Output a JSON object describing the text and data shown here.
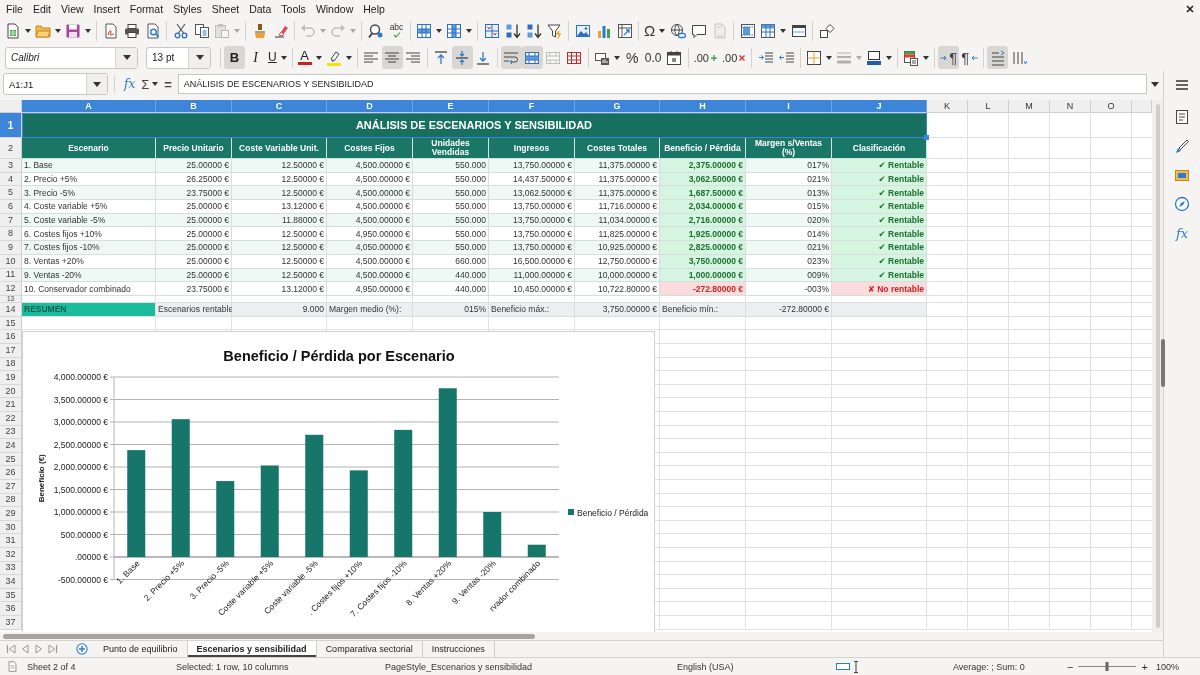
{
  "menu_bar": [
    "File",
    "Edit",
    "View",
    "Insert",
    "Format",
    "Styles",
    "Sheet",
    "Data",
    "Tools",
    "Window",
    "Help"
  ],
  "standard_toolbar": {
    "paste": {
      "disabled": true
    },
    "undo": {
      "disabled": true
    },
    "redo": {
      "disabled": true
    },
    "spelling": "abc",
    "special_character": "Ω",
    "headers_footers": {
      "disabled": true
    }
  },
  "formatting_toolbar": {
    "font_name": "Calibri",
    "font_size": "13 pt",
    "bold": {
      "label": "B",
      "on": true
    },
    "italic": {
      "label": "I",
      "on": false
    },
    "underline": {
      "label": "U",
      "on": false
    },
    "font_color": {
      "label": "A"
    },
    "align_left": {
      "on": false
    },
    "align_center": {
      "on": true
    },
    "align_right": {
      "on": false
    },
    "align_top": {
      "on": false
    },
    "align_middle": {
      "on": true
    },
    "align_bottom": {
      "on": false
    },
    "wrap_text": {
      "on": true
    },
    "merge_and_center": {
      "on": true
    },
    "merge_cells": {
      "disabled": true
    },
    "percent": "%",
    "standard_number": "0.0",
    "add_decimal": ".00",
    "delete_decimal": ".00",
    "border_style": {
      "disabled": true
    },
    "left_to_right": {
      "label": "¶",
      "on": true
    },
    "right_to_left": {
      "label": "¶",
      "on": false
    },
    "text_horizontal": {
      "on": true
    },
    "text_vertical": {
      "on": false
    }
  },
  "formula_bar": {
    "name_box": "A1:J1",
    "function_wizard": "fx",
    "sum": "Σ",
    "equals": "=",
    "content": "ANÁLISIS DE ESCENARIOS Y SENSIBILIDAD"
  },
  "column_headers": [
    {
      "label": "A",
      "selected": true
    },
    {
      "label": "B",
      "selected": true
    },
    {
      "label": "C",
      "selected": true
    },
    {
      "label": "D",
      "selected": true
    },
    {
      "label": "E",
      "selected": true
    },
    {
      "label": "F",
      "selected": true
    },
    {
      "label": "G",
      "selected": true
    },
    {
      "label": "H",
      "selected": true
    },
    {
      "label": "I",
      "selected": true
    },
    {
      "label": "J",
      "selected": true
    },
    {
      "label": "K",
      "selected": false
    },
    {
      "label": "L",
      "selected": false
    },
    {
      "label": "M",
      "selected": false
    },
    {
      "label": "N",
      "selected": false
    },
    {
      "label": "O",
      "selected": false
    }
  ],
  "row_headers": [
    {
      "label": "1",
      "selected": true
    },
    {
      "label": "2",
      "selected": false
    },
    {
      "label": "3",
      "selected": false
    },
    {
      "label": "4",
      "selected": false
    },
    {
      "label": "5",
      "selected": false
    },
    {
      "label": "6",
      "selected": false
    },
    {
      "label": "7",
      "selected": false
    },
    {
      "label": "8",
      "selected": false
    },
    {
      "label": "9",
      "selected": false
    },
    {
      "label": "10",
      "selected": false
    },
    {
      "label": "11",
      "selected": false
    },
    {
      "label": "12",
      "selected": false
    },
    {
      "label": "13",
      "selected": false
    },
    {
      "label": "14",
      "selected": false
    },
    {
      "label": "15",
      "selected": false
    },
    {
      "label": "16",
      "selected": false
    },
    {
      "label": "17",
      "selected": false
    },
    {
      "label": "18",
      "selected": false
    },
    {
      "label": "19",
      "selected": false
    },
    {
      "label": "20",
      "selected": false
    },
    {
      "label": "21",
      "selected": false
    },
    {
      "label": "22",
      "selected": false
    },
    {
      "label": "23",
      "selected": false
    },
    {
      "label": "24",
      "selected": false
    },
    {
      "label": "25",
      "selected": false
    },
    {
      "label": "26",
      "selected": false
    },
    {
      "label": "27",
      "selected": false
    },
    {
      "label": "28",
      "selected": false
    },
    {
      "label": "29",
      "selected": false
    },
    {
      "label": "30",
      "selected": false
    },
    {
      "label": "31",
      "selected": false
    },
    {
      "label": "32",
      "selected": false
    },
    {
      "label": "33",
      "selected": false
    },
    {
      "label": "34",
      "selected": false
    },
    {
      "label": "35",
      "selected": false
    },
    {
      "label": "36",
      "selected": false
    },
    {
      "label": "37",
      "selected": false
    }
  ],
  "sheet": {
    "title": "ANÁLISIS DE ESCENARIOS Y SENSIBILIDAD",
    "headers": [
      "Escenario",
      "Precio Unitario",
      "Coste Variable Unit.",
      "Costes Fijos",
      "Unidades Vendidas",
      "Ingresos",
      "Costes Totales",
      "Beneficio / Pérdida",
      "Margen s/Ventas (%)",
      "Clasificación"
    ],
    "scenarios": [
      {
        "cells": [
          "1. Base",
          "25.00000 €",
          "12.50000 €",
          "4,500.00000 €",
          "550.000",
          "13,750.00000 €",
          "11,375.00000 €",
          "2,375.00000 €",
          "017%",
          "✔ Rentable"
        ],
        "profitable": true
      },
      {
        "cells": [
          "2. Precio +5%",
          "26.25000 €",
          "12.50000 €",
          "4,500.00000 €",
          "550.000",
          "14,437.50000 €",
          "11,375.00000 €",
          "3,062.50000 €",
          "021%",
          "✔ Rentable"
        ],
        "profitable": true
      },
      {
        "cells": [
          "3. Precio -5%",
          "23.75000 €",
          "12.50000 €",
          "4,500.00000 €",
          "550.000",
          "13,062.50000 €",
          "11,375.00000 €",
          "1,687.50000 €",
          "013%",
          "✔ Rentable"
        ],
        "profitable": true
      },
      {
        "cells": [
          "4. Coste variable +5%",
          "25.00000 €",
          "13.12000 €",
          "4,500.00000 €",
          "550.000",
          "13,750.00000 €",
          "11,716.00000 €",
          "2,034.00000 €",
          "015%",
          "✔ Rentable"
        ],
        "profitable": true
      },
      {
        "cells": [
          "5. Coste variable -5%",
          "25.00000 €",
          "11.88000 €",
          "4,500.00000 €",
          "550.000",
          "13,750.00000 €",
          "11,034.00000 €",
          "2,716.00000 €",
          "020%",
          "✔ Rentable"
        ],
        "profitable": true
      },
      {
        "cells": [
          "6. Costes fijos +10%",
          "25.00000 €",
          "12.50000 €",
          "4,950.00000 €",
          "550.000",
          "13,750.00000 €",
          "11,825.00000 €",
          "1,925.00000 €",
          "014%",
          "✔ Rentable"
        ],
        "profitable": true
      },
      {
        "cells": [
          "7. Costes fijos -10%",
          "25.00000 €",
          "12.50000 €",
          "4,050.00000 €",
          "550.000",
          "13,750.00000 €",
          "10,925.00000 €",
          "2,825.00000 €",
          "021%",
          "✔ Rentable"
        ],
        "profitable": true
      },
      {
        "cells": [
          "8. Ventas +20%",
          "25.00000 €",
          "12.50000 €",
          "4,500.00000 €",
          "660.000",
          "16,500.00000 €",
          "12,750.00000 €",
          "3,750.00000 €",
          "023%",
          "✔ Rentable"
        ],
        "profitable": true
      },
      {
        "cells": [
          "9. Ventas -20%",
          "25.00000 €",
          "12.50000 €",
          "4,500.00000 €",
          "440.000",
          "11,000.00000 €",
          "10,000.00000 €",
          "1,000.00000 €",
          "009%",
          "✔ Rentable"
        ],
        "profitable": true
      },
      {
        "cells": [
          "10. Conservador combinado",
          "23.75000 €",
          "13.12000 €",
          "4,950.00000 €",
          "440.000",
          "10,450.00000 €",
          "10,722.80000 €",
          "-272.80000 €",
          "-003%",
          "✘ No rentable"
        ],
        "profitable": false
      }
    ],
    "summary": {
      "label": "RESUMEN",
      "cells": [
        "Escenarios rentable",
        "9.000",
        "Margen medio (%):",
        "015%",
        "Beneficio máx.:",
        "3,750.00000 €",
        "Beneficio mín.:",
        "-272.80000 €"
      ]
    }
  },
  "chart": {
    "chart_data": {
      "type": "bar",
      "title": "Beneficio / Pérdida por Escenario",
      "ylabel": "Beneficio (€)",
      "categories": [
        "1. Base",
        "2. Precio +5%",
        "3. Precio -5%",
        "Coste variable +5%",
        "Coste variable -5%",
        ". Costes fijos +10%",
        "7. Costes fijos -10%",
        "8. Ventas +20%",
        "9. Ventas -20%",
        "rvador combinado"
      ],
      "series": [
        {
          "name": "Beneficio / Pérdida",
          "color": "#17766a",
          "values": [
            2375,
            3062.5,
            1687.5,
            2034,
            2716,
            1925,
            2825,
            3750,
            1000,
            272.8
          ]
        }
      ],
      "ylim": [
        -500,
        4000
      ],
      "yticks": [
        {
          "value": -500,
          "label": "-500.00000 €"
        },
        {
          "value": 0,
          "label": ".00000 €"
        },
        {
          "value": 500,
          "label": "500.00000 €"
        },
        {
          "value": 1000,
          "label": "1,000.00000 €"
        },
        {
          "value": 1500,
          "label": "1,500.00000 €"
        },
        {
          "value": 2000,
          "label": "2,000.00000 €"
        },
        {
          "value": 2500,
          "label": "2,500.00000 €"
        },
        {
          "value": 3000,
          "label": "3,000.00000 €"
        },
        {
          "value": 3500,
          "label": "3,500.00000 €"
        },
        {
          "value": 4000,
          "label": "4,000.00000 €"
        }
      ],
      "grid": true
    }
  },
  "sidebar": {
    "functions": "fx"
  },
  "sheet_tabs": [
    {
      "label": "Punto de equilibrio",
      "selected": false
    },
    {
      "label": "Escenarios y sensibilidad",
      "selected": true
    },
    {
      "label": "Comparativa sectorial",
      "selected": false
    },
    {
      "label": "Instrucciones",
      "selected": false
    }
  ],
  "status_bar": {
    "sheet": "Sheet 2 of 4",
    "selection": "Selected: 1 row, 10 columns",
    "page_style": "PageStyle_Escenarios y sensibilidad",
    "language": "English (USA)",
    "summary": "Average: ; Sum: 0",
    "zoom_out": "−",
    "zoom_in": "+",
    "zoom": {
      "level": 0.5
    },
    "zoom_reading": "100%"
  }
}
